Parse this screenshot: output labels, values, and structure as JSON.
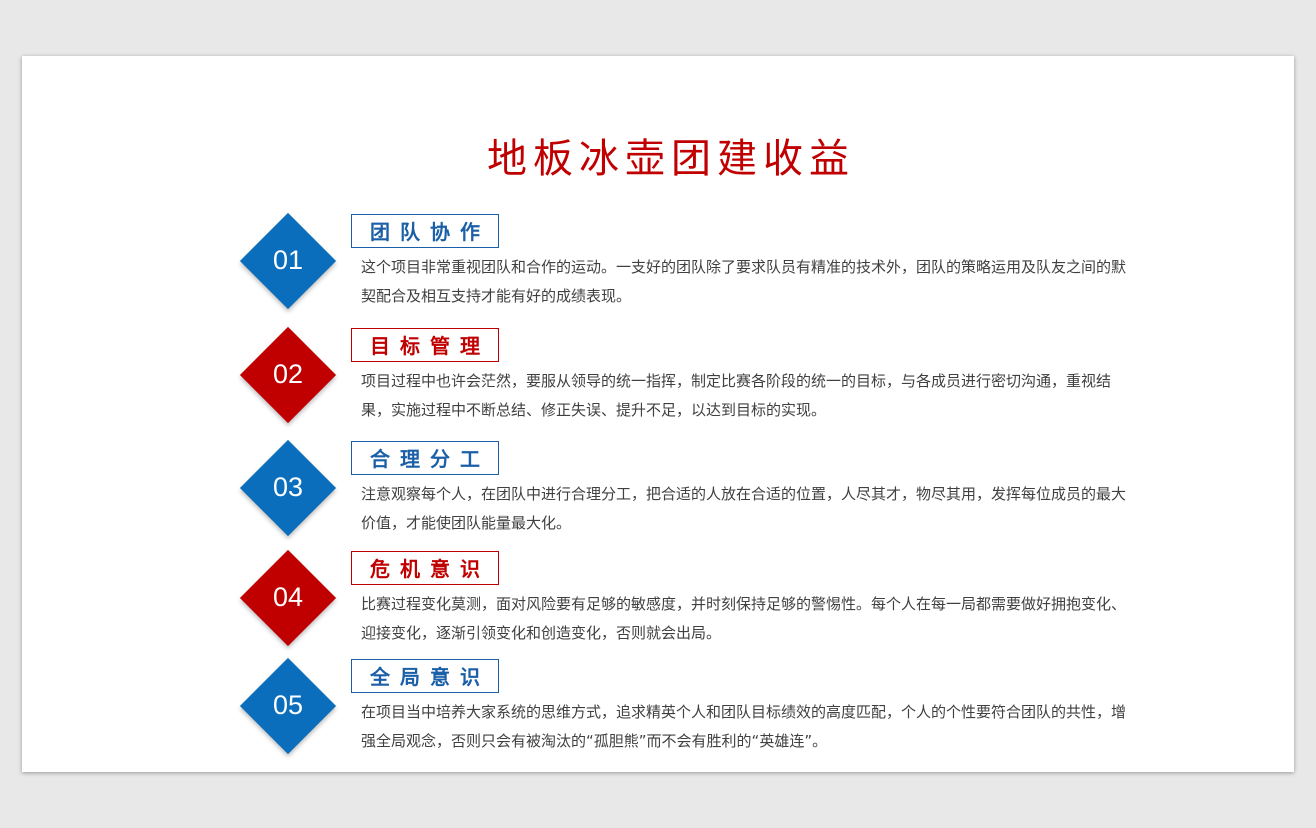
{
  "slide": {
    "title": "地板冰壶团建收益",
    "items": [
      {
        "number": "01",
        "heading": "团队协作",
        "text": "这个项目非常重视团队和合作的运动。一支好的团队除了要求队员有精准的技术外，团队的策略运用及队友之间的默契配合及相互支持才能有好的成绩表现。"
      },
      {
        "number": "02",
        "heading": "目标管理",
        "text": "项目过程中也许会茫然，要服从领导的统一指挥，制定比赛各阶段的统一的目标，与各成员进行密切沟通，重视结果，实施过程中不断总结、修正失误、提升不足，以达到目标的实现。"
      },
      {
        "number": "03",
        "heading": "合理分工",
        "text": "注意观察每个人，在团队中进行合理分工，把合适的人放在合适的位置，人尽其才，物尽其用，发挥每位成员的最大价值，才能使团队能量最大化。"
      },
      {
        "number": "04",
        "heading": "危机意识",
        "text": "比赛过程变化莫测，面对风险要有足够的敏感度，并时刻保持足够的警惕性。每个人在每一局都需要做好拥抱变化、迎接变化，逐渐引领变化和创造变化，否则就会出局。"
      },
      {
        "number": "05",
        "heading": "全局意识",
        "text": "在项目当中培养大家系统的思维方式，追求精英个人和团队目标绩效的高度匹配，个人的个性要符合团队的共性，增强全局观念，否则只会有被淘汰的“孤胆熊”而不会有胜利的“英雄连”。"
      }
    ]
  },
  "colors": {
    "blue": "#0a6ebd",
    "red": "#c00000",
    "background": "#e8e8e8",
    "slide": "#ffffff"
  }
}
